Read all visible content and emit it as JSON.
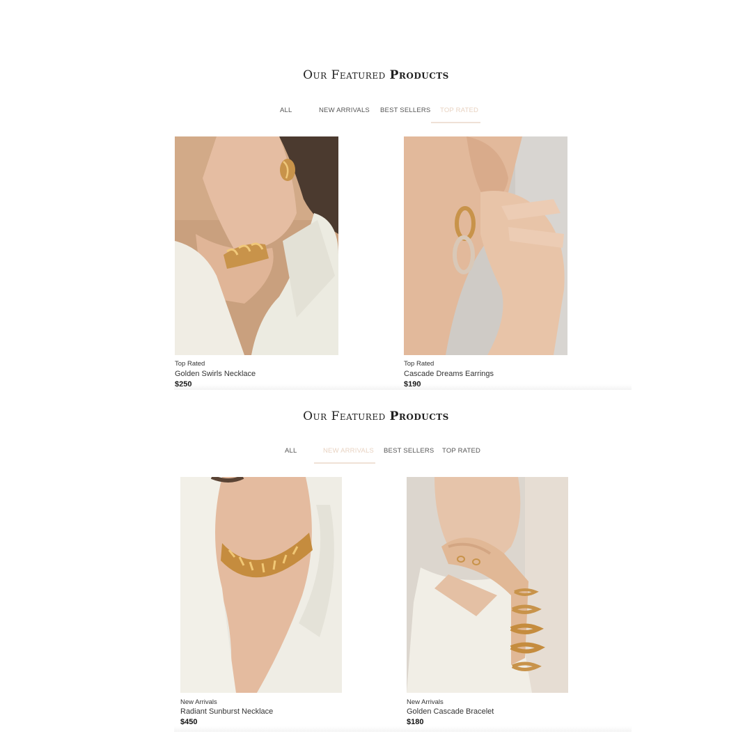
{
  "sections": [
    {
      "heading_light": "Our Featured",
      "heading_bold": "Products",
      "tabs": [
        {
          "label": "ALL",
          "active": false
        },
        {
          "label": "NEW ARRIVALS",
          "active": false
        },
        {
          "label": "BEST SELLERS",
          "active": false
        },
        {
          "label": "TOP RATED",
          "active": true
        }
      ],
      "products": [
        {
          "category": "Top Rated",
          "name": "Golden Swirls Necklace",
          "price": "$250"
        },
        {
          "category": "Top Rated",
          "name": "Cascade Dreams Earrings",
          "price": "$190"
        }
      ]
    },
    {
      "heading_light": "Our Featured",
      "heading_bold": "Products",
      "tabs": [
        {
          "label": "ALL",
          "active": false
        },
        {
          "label": "NEW ARRIVALS",
          "active": true
        },
        {
          "label": "BEST SELLERS",
          "active": false
        },
        {
          "label": "TOP RATED",
          "active": false
        }
      ],
      "products": [
        {
          "category": "New Arrivals",
          "name": "Radiant Sunburst Necklace",
          "price": "$450"
        },
        {
          "category": "New Arrivals",
          "name": "Golden Cascade Bracelet",
          "price": "$180"
        }
      ]
    }
  ],
  "colors": {
    "active_tab": "#e8d3c2",
    "inactive_tab": "#555555",
    "gold": "#c8934a",
    "skin": "#e3b899",
    "cream": "#f1efe7"
  }
}
